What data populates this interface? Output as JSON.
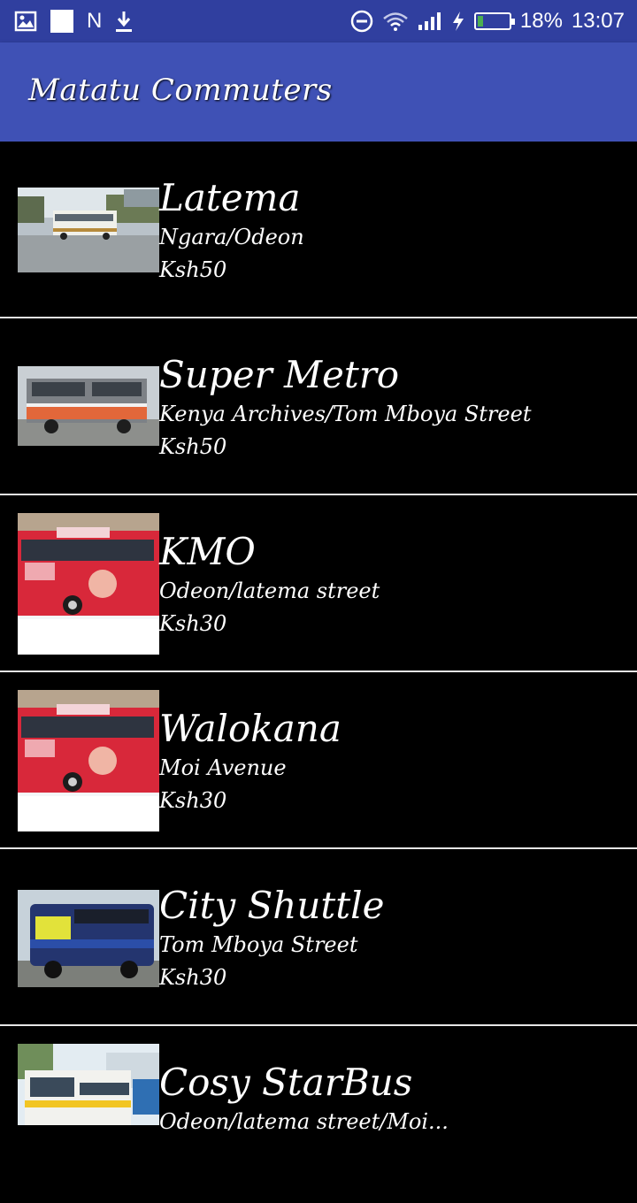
{
  "status_bar": {
    "left_icons": [
      "image-icon",
      "square-icon",
      "n-icon",
      "download-icon"
    ],
    "n_label": "N",
    "right_icons": [
      "do-not-disturb-icon",
      "wifi-icon",
      "signal-icon",
      "charging-icon",
      "battery-icon"
    ],
    "battery_percent": "18%",
    "battery_level": 0.18,
    "time": "13:07"
  },
  "app_bar": {
    "title": "Matatu Commuters",
    "color": "#3F51B5"
  },
  "matatus": [
    {
      "name": "Latema",
      "route": "Ngara/Odeon",
      "fare": "Ksh50",
      "image": "white-bus-photo"
    },
    {
      "name": "Super Metro",
      "route": "Kenya Archives/Tom Mboya Street",
      "fare": "Ksh50",
      "image": "orange-grey-bus-photo"
    },
    {
      "name": "KMO",
      "route": "Odeon/latema street",
      "fare": "Ksh30",
      "image": "red-graffiti-bus-photo"
    },
    {
      "name": "Walokana",
      "route": "Moi Avenue",
      "fare": "Ksh30",
      "image": "red-graffiti-bus-photo"
    },
    {
      "name": "City Shuttle",
      "route": "Tom Mboya Street",
      "fare": "Ksh30",
      "image": "blue-yellow-bus-photo"
    },
    {
      "name": "Cosy StarBus",
      "route": "Odeon/latema street/Moi...",
      "fare": "",
      "image": "white-yellow-bus-photo"
    }
  ]
}
